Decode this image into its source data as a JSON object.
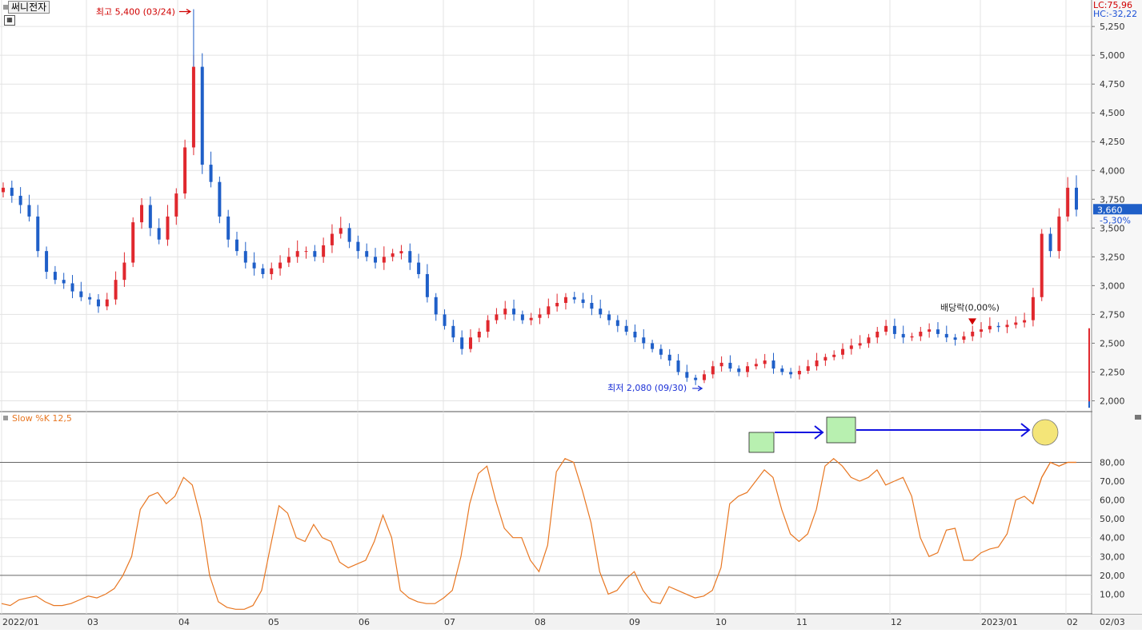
{
  "stock_name": "써니전자",
  "lc_label": "LC:75,96",
  "hc_label": "HC:-32,22",
  "annotations": {
    "high": "최고 5,400 (03/24)",
    "low": "최저 2,080 (09/30)",
    "dividend": "배당락(0,00%)"
  },
  "current_price_label": "3,660",
  "current_change_label": "-5,30%",
  "colors": {
    "up": "#e0282e",
    "down": "#1f5fc8",
    "stoch": "#e87722",
    "price_tag": "#1f5fc8",
    "highlight": "#b8f0b0",
    "circle": "#f2e060"
  },
  "chart_data": [
    {
      "type": "candlestick",
      "title": "써니전자",
      "y_ticks": [
        "5,250",
        "5,000",
        "4,750",
        "4,500",
        "4,250",
        "4,000",
        "3,750",
        "3,500",
        "3,250",
        "3,000",
        "2,750",
        "2,500",
        "2,250",
        "2,000"
      ],
      "y_tick_values": [
        5250,
        5000,
        4750,
        4500,
        4250,
        4000,
        3750,
        3500,
        3250,
        3000,
        2750,
        2500,
        2250,
        2000
      ],
      "ylim": [
        1920,
        5480
      ],
      "x_ticks": [
        "2022/01",
        "03",
        "04",
        "05",
        "06",
        "07",
        "08",
        "09",
        "10",
        "11",
        "12",
        "2023/01",
        "02",
        "02/03"
      ],
      "close_path": [
        3850,
        3780,
        3700,
        3600,
        3300,
        3120,
        3050,
        3020,
        2950,
        2900,
        2880,
        2820,
        2880,
        3050,
        3200,
        3550,
        3700,
        3500,
        3400,
        3600,
        3800,
        4200,
        4900,
        4050,
        3900,
        3600,
        3400,
        3300,
        3200,
        3150,
        3100,
        3150,
        3200,
        3250,
        3300,
        3300,
        3250,
        3350,
        3450,
        3500,
        3380,
        3300,
        3250,
        3200,
        3250,
        3280,
        3300,
        3200,
        3100,
        2900,
        2750,
        2650,
        2550,
        2450,
        2550,
        2600,
        2700,
        2750,
        2800,
        2750,
        2700,
        2720,
        2750,
        2820,
        2850,
        2900,
        2880,
        2850,
        2800,
        2750,
        2700,
        2650,
        2600,
        2550,
        2500,
        2450,
        2400,
        2350,
        2250,
        2200,
        2180,
        2230,
        2300,
        2330,
        2280,
        2250,
        2300,
        2320,
        2350,
        2280,
        2250,
        2230,
        2260,
        2300,
        2350,
        2380,
        2400,
        2450,
        2480,
        2500,
        2550,
        2600,
        2650,
        2580,
        2550,
        2560,
        2600,
        2620,
        2580,
        2550,
        2530,
        2560,
        2600,
        2620,
        2650,
        2640,
        2660,
        2680,
        2700,
        2900,
        3450,
        3300,
        3600,
        3850,
        3660
      ],
      "high": 5400,
      "high_date": "03/24",
      "low": 2080,
      "low_date": "09/30",
      "last_close": 3660,
      "change_pct": -5.3
    },
    {
      "type": "line",
      "title": "Slow %K 12,5",
      "series": [
        {
          "name": "Slow %K 12,5",
          "values": [
            5,
            4,
            7,
            8,
            9,
            6,
            4,
            4,
            5,
            7,
            9,
            8,
            10,
            13,
            20,
            30,
            55,
            62,
            64,
            58,
            62,
            72,
            68,
            50,
            20,
            6,
            3,
            2,
            2,
            4,
            12,
            35,
            57,
            53,
            40,
            38,
            47,
            40,
            38,
            27,
            24,
            26,
            28,
            38,
            52,
            40,
            12,
            8,
            6,
            5,
            5,
            8,
            12,
            30,
            58,
            74,
            78,
            60,
            45,
            40,
            40,
            28,
            22,
            36,
            75,
            82,
            80,
            65,
            48,
            22,
            10,
            12,
            18,
            22,
            12,
            6,
            5,
            14,
            12,
            10,
            8,
            9,
            12,
            24,
            58,
            62,
            64,
            70,
            76,
            72,
            55,
            42,
            38,
            42,
            55,
            78,
            82,
            78,
            72,
            70,
            72,
            76,
            68,
            70,
            72,
            62,
            40,
            30,
            32,
            44,
            45,
            28,
            28,
            32,
            34,
            35,
            42,
            60,
            62,
            58,
            72,
            80,
            78,
            80,
            80
          ]
        }
      ],
      "y_ticks": [
        "80,00",
        "70,00",
        "60,00",
        "50,00",
        "40,00",
        "30,00",
        "20,00",
        "10,00"
      ],
      "y_tick_values": [
        80,
        70,
        60,
        50,
        40,
        30,
        20,
        10
      ],
      "ylim": [
        0,
        101
      ],
      "reference_lines": [
        80,
        20
      ]
    }
  ]
}
